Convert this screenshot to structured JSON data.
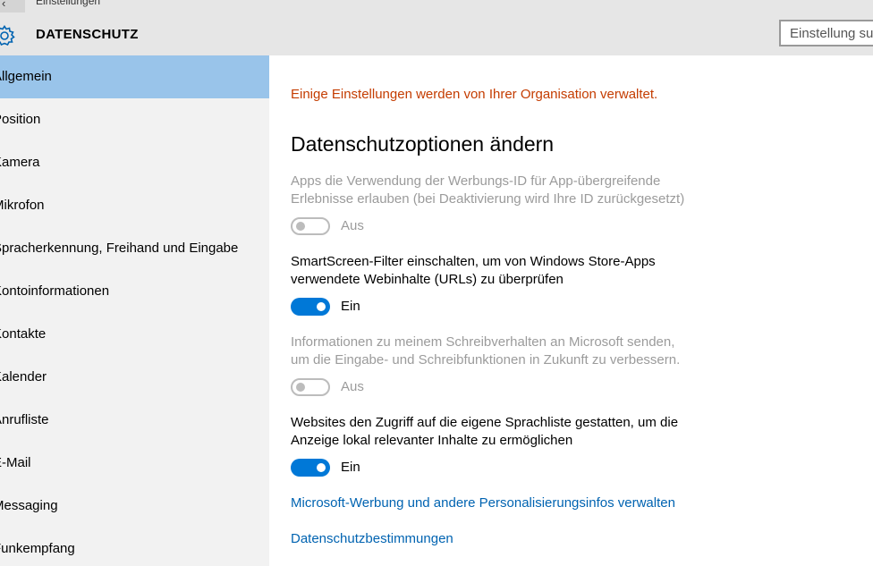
{
  "window": {
    "title": "Einstellungen",
    "back_icon": "back-arrow-icon"
  },
  "header": {
    "icon": "gear-icon",
    "title": "DATENSCHUTZ",
    "search_placeholder": "Einstellung suchen"
  },
  "sidebar": {
    "items": [
      {
        "label": "Allgemein",
        "active": true
      },
      {
        "label": "Position"
      },
      {
        "label": "Kamera"
      },
      {
        "label": "Mikrofon"
      },
      {
        "label": "Spracherkennung, Freihand und Eingabe"
      },
      {
        "label": "Kontoinformationen"
      },
      {
        "label": "Kontakte"
      },
      {
        "label": "Kalender"
      },
      {
        "label": "Anrufliste"
      },
      {
        "label": "E-Mail"
      },
      {
        "label": "Messaging"
      },
      {
        "label": "Funkempfang"
      }
    ]
  },
  "main": {
    "notice": "Einige Einstellungen werden von Ihrer Organisation verwaltet.",
    "section_title": "Datenschutzoptionen ändern",
    "settings": [
      {
        "line1": "Apps die Verwendung der Werbungs-ID für App-übergreifende",
        "line2": "Erlebnisse erlauben (bei Deaktivierung wird Ihre ID zurückgesetzt)",
        "state": "Aus",
        "enabled": false
      },
      {
        "line1": "SmartScreen-Filter einschalten, um von Windows Store-Apps",
        "line2": "verwendete Webinhalte (URLs) zu überprüfen",
        "state": "Ein",
        "enabled": true
      },
      {
        "line1": "Informationen zu meinem Schreibverhalten an Microsoft senden,",
        "line2": "um die Eingabe- und Schreibfunktionen in Zukunft zu verbessern.",
        "state": "Aus",
        "enabled": false
      },
      {
        "line1": "Websites den Zugriff auf die eigene Sprachliste gestatten, um die",
        "line2": "Anzeige lokal relevanter Inhalte zu ermöglichen",
        "state": "Ein",
        "enabled": true
      }
    ],
    "links": [
      "Microsoft-Werbung und andere Personalisierungsinfos verwalten",
      "Datenschutzbestimmungen"
    ]
  },
  "colors": {
    "accent": "#0078d7",
    "notice": "#c43c00",
    "link": "#0063b1",
    "sidebar_active": "#99c4ea",
    "disabled_text": "#9b9b9b"
  }
}
